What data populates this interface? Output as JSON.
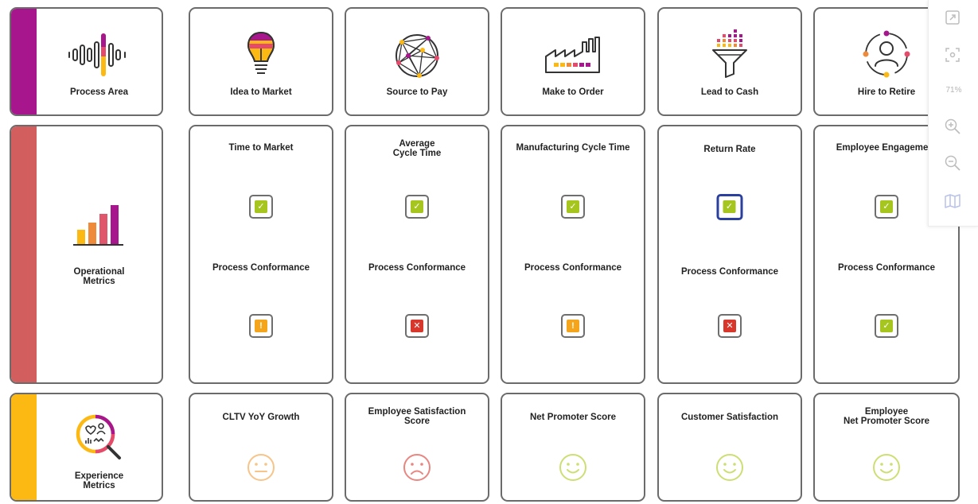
{
  "rows": {
    "process_area": {
      "label": "Process Area",
      "accent": "#a7168d",
      "icon": "sound-wave-icon"
    },
    "operational": {
      "label": "Operational\nMetrics",
      "accent": "#d25e5e",
      "icon": "bar-chart-icon"
    },
    "experience": {
      "label": "Experience\nMetrics",
      "accent": "#fdb913",
      "icon": "magnifier-heart-user-icon"
    }
  },
  "columns": [
    {
      "process": "Idea to Market",
      "icon": "lightbulb-icon",
      "op_metric": "Time to Market",
      "op_status": "check",
      "conf_label": "Process Conformance",
      "conf_status": "warning",
      "exp_metric": "CLTV YoY Growth",
      "exp_face": "neutral"
    },
    {
      "process": "Source to Pay",
      "icon": "network-globe-icon",
      "op_metric": "Average\nCycle Time",
      "op_status": "check",
      "conf_label": "Process Conformance",
      "conf_status": "error",
      "exp_metric": "Employee Satisfaction\nScore",
      "exp_face": "sad"
    },
    {
      "process": "Make to Order",
      "icon": "factory-icon",
      "op_metric": "Manufacturing Cycle Time",
      "op_status": "check",
      "conf_label": "Process Conformance",
      "conf_status": "warning",
      "exp_metric": "Net Promoter Score",
      "exp_face": "happy"
    },
    {
      "process": "Lead to Cash",
      "icon": "funnel-icon",
      "op_metric": "Return Rate",
      "op_status": "check",
      "op_selected": true,
      "conf_label": "Process Conformance",
      "conf_status": "error",
      "exp_metric": "Customer Satisfaction",
      "exp_face": "happy"
    },
    {
      "process": "Hire to Retire",
      "icon": "person-cycle-icon",
      "op_metric": "Employee Engagement",
      "op_status": "check",
      "conf_label": "Process Conformance",
      "conf_status": "check",
      "exp_metric": "Employee\nNet Promoter Score",
      "exp_face": "happy"
    }
  ],
  "toolbar": {
    "zoom": "71%"
  },
  "colors": {
    "check": "#a6c51f",
    "warning": "#f4a51c",
    "error": "#d8382c",
    "face_neutral": "#f7c489",
    "face_sad": "#e88782",
    "face_happy": "#cddf74",
    "selected_border": "#2a3f9e"
  }
}
